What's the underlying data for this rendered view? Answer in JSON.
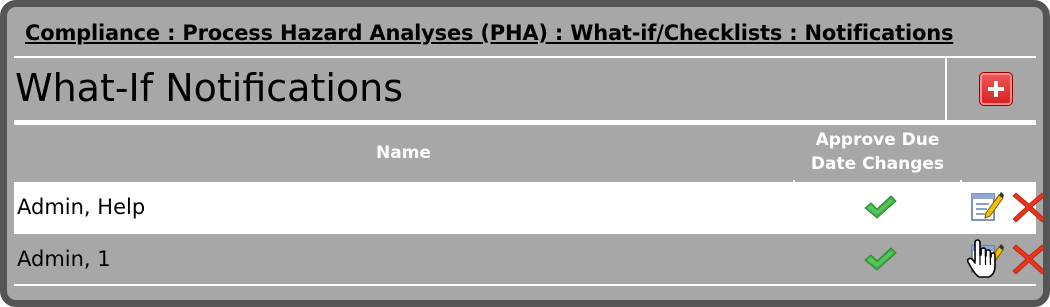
{
  "breadcrumb": "Compliance : Process Hazard Analyses (PHA) : What-if/Checklists : Notifications",
  "page_title": "What-If Notifications",
  "toolbar": {
    "add_icon": "plus-icon",
    "add_color": "#e02a2a"
  },
  "table": {
    "columns": [
      {
        "label": "Name"
      },
      {
        "label": "Approve Due Date Changes"
      },
      {
        "label": ""
      }
    ],
    "rows": [
      {
        "name": "Admin, Help",
        "approve_due_date_changes": true,
        "actions": [
          "edit-icon",
          "delete-icon"
        ]
      },
      {
        "name": "Admin, 1",
        "approve_due_date_changes": true,
        "actions": [
          "edit-icon",
          "delete-icon"
        ]
      }
    ]
  },
  "colors": {
    "frame_border": "#555555",
    "panel_gray": "#a7a7a7",
    "header_text": "#ffffff",
    "check_green": "#3cb043",
    "delete_red": "#e8341c"
  }
}
